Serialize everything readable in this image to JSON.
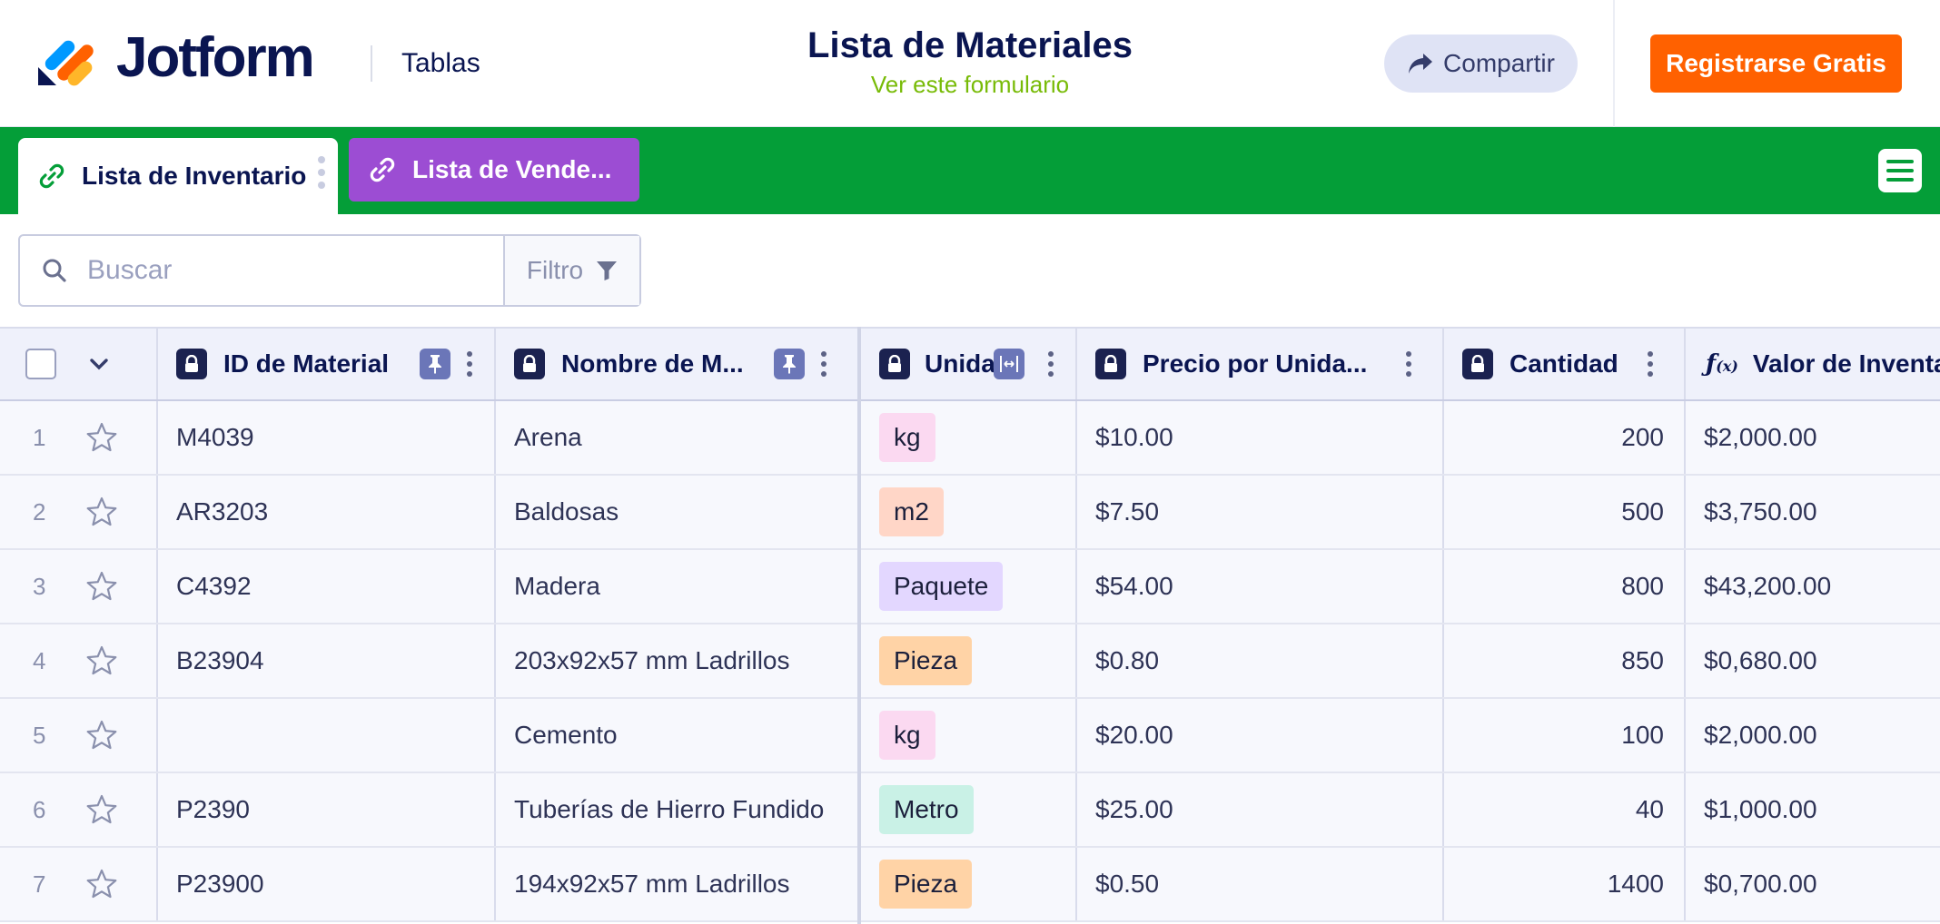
{
  "header": {
    "brand": "Jotform",
    "section": "Tablas",
    "form_title": "Lista de Materiales",
    "form_link": "Ver este formulario",
    "share_label": "Compartir",
    "signup_label": "Registrarse Gratis"
  },
  "tabs": [
    {
      "label": "Lista de Inventario",
      "active": true
    },
    {
      "label": "Lista de Vende...",
      "active": false
    }
  ],
  "toolbar": {
    "search_placeholder": "Buscar",
    "filter_label": "Filtro"
  },
  "table": {
    "columns": [
      {
        "label": "ID de Material"
      },
      {
        "label": "Nombre de M..."
      },
      {
        "label": "Unida"
      },
      {
        "label": "Precio por Unida..."
      },
      {
        "label": "Cantidad"
      },
      {
        "label": "Valor de Inventa"
      }
    ],
    "rows": [
      {
        "num": "1",
        "id": "M4039",
        "name": "Arena",
        "unit": "kg",
        "unit_color": "#fbd9f1",
        "price": "$10.00",
        "qty": "200",
        "value": "$2,000.00"
      },
      {
        "num": "2",
        "id": "AR3203",
        "name": "Baldosas",
        "unit": "m2",
        "unit_color": "#ffd6c7",
        "price": "$7.50",
        "qty": "500",
        "value": "$3,750.00"
      },
      {
        "num": "3",
        "id": "C4392",
        "name": "Madera",
        "unit": "Paquete",
        "unit_color": "#e3d7ff",
        "price": "$54.00",
        "qty": "800",
        "value": "$43,200.00"
      },
      {
        "num": "4",
        "id": "B23904",
        "name": "203x92x57 mm Ladrillos",
        "unit": "Pieza",
        "unit_color": "#ffd3a6",
        "price": "$0.80",
        "qty": "850",
        "value": "$0,680.00"
      },
      {
        "num": "5",
        "id": "",
        "name": "Cemento",
        "unit": "kg",
        "unit_color": "#fbd9f1",
        "price": "$20.00",
        "qty": "100",
        "value": "$2,000.00"
      },
      {
        "num": "6",
        "id": "P2390",
        "name": "Tuberías de Hierro Fundido",
        "unit": "Metro",
        "unit_color": "#c9f1e6",
        "price": "$25.00",
        "qty": "40",
        "value": "$1,000.00"
      },
      {
        "num": "7",
        "id": "P23900",
        "name": "194x92x57 mm Ladrillos",
        "unit": "Pieza",
        "unit_color": "#ffd3a6",
        "price": "$0.50",
        "qty": "1400",
        "value": "$0,700.00"
      }
    ]
  },
  "colors": {
    "brand_navy": "#0a1551",
    "tab_bar_green": "#049e38",
    "signup_orange": "#ff6100",
    "second_tab_purple": "#9c4dd3",
    "form_link_green": "#78bb07"
  },
  "icons": [
    "jotform-logo-icon",
    "share-arrow-icon",
    "link-icon",
    "hamburger-menu-icon",
    "search-icon",
    "filter-funnel-icon",
    "lock-icon",
    "pin-icon",
    "kebab-menu-icon",
    "column-resize-icon",
    "formula-icon",
    "star-icon",
    "chevron-down-icon"
  ]
}
